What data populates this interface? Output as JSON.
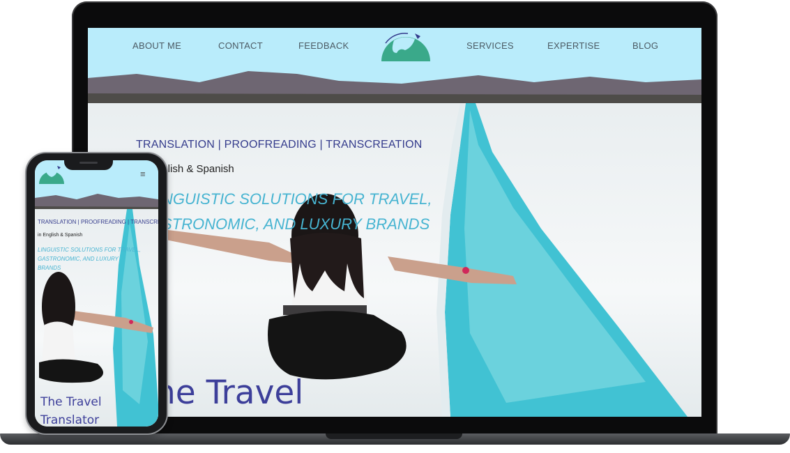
{
  "laptop": {
    "nav": {
      "left": [
        "ABOUT ME",
        "CONTACT",
        "FEEDBACK"
      ],
      "right": [
        "SERVICES",
        "EXPERTISE",
        "BLOG"
      ],
      "logo_icon": "globe-logo-icon"
    },
    "hero": {
      "services": "TRANSLATION  |  PROOFREADING  |  TRANSCREATION",
      "languages": "nglish & Spanish",
      "tagline": "NGUISTIC SOLUTIONS FOR TRAVEL, STRONOMIC, AND LUXURY BRANDS",
      "title": "he Travel"
    }
  },
  "phone": {
    "menu_icon": "≡",
    "services": "TRANSLATION  |  PROOFREADING  |  TRANSCREATION",
    "languages": "in English & Spanish",
    "tagline": "LINGUISTIC SOLUTIONS FOR TRAVEL, GASTRONOMIC, AND LUXURY BRANDS",
    "title": "The Travel Translator"
  },
  "colors": {
    "sky": "#b9ecfb",
    "navy": "#343b8c",
    "teal": "#47b4d1",
    "logo_green": "#3aa98a"
  }
}
